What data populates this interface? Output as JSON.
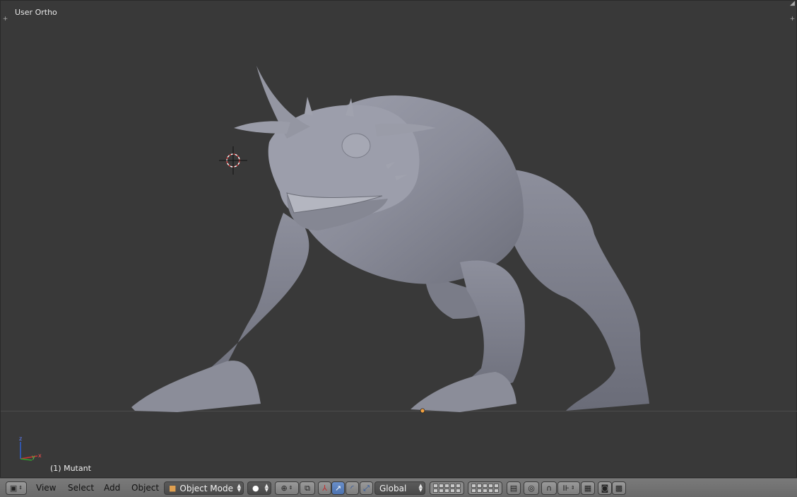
{
  "viewport": {
    "view_label": "User Ortho",
    "object_label": "(1) Mutant",
    "background_color": "#393939",
    "axes": {
      "x": "x",
      "y": "y",
      "z": "z"
    }
  },
  "header": {
    "editor_type_icon": "3d-view-icon",
    "menus": {
      "view": "View",
      "select": "Select",
      "add": "Add",
      "object": "Object"
    },
    "mode": {
      "icon": "cube-icon",
      "label": "Object Mode"
    },
    "shading_icon": "solid-sphere-icon",
    "pivot_icon": "pivot-point-icon",
    "manipulator_icons": [
      "transform-toggle-icon",
      "translate-icon",
      "rotate-icon",
      "scale-icon"
    ],
    "orientation": "Global",
    "layer_groups": 2,
    "right_icons": [
      "layer-lock-icon",
      "proportional-edit-icon",
      "snap-icon",
      "snap-element-icon",
      "render-preview-icon",
      "render-icon",
      "render-animation-icon"
    ]
  }
}
